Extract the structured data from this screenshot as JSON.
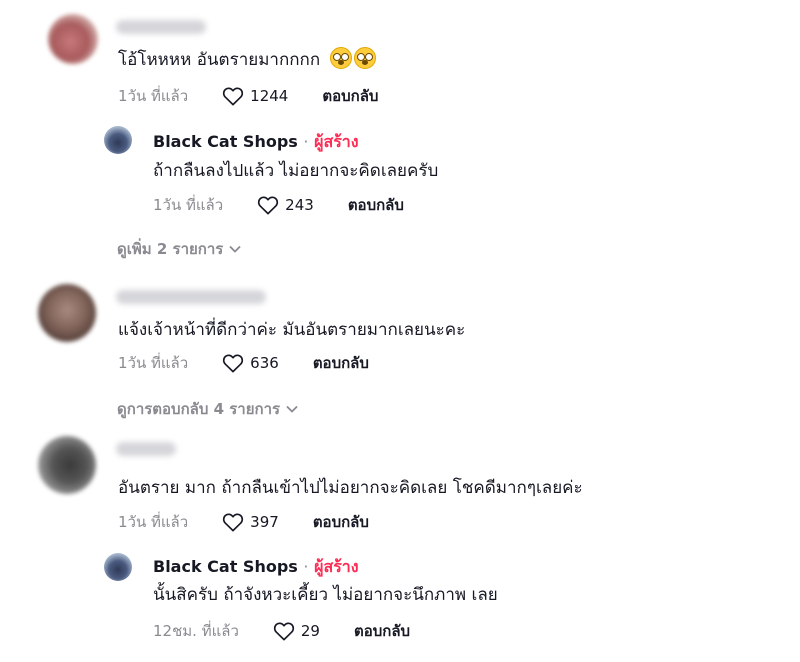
{
  "comments": [
    {
      "text": "โอ้โหหหห อันตรายมากกกก",
      "emoji": [
        "flushed-face-emoji",
        "flushed-face-emoji"
      ],
      "time": "1วัน ที่แล้ว",
      "likes": "1244",
      "reply_label": "ตอบกลับ",
      "reply": {
        "author": "Black Cat Shops",
        "separator": "·",
        "badge": "ผู้สร้าง",
        "text": "ถ้ากลืนลงไปแล้ว ไม่อยากจะคิดเลยครับ",
        "time": "1วัน ที่แล้ว",
        "likes": "243",
        "reply_label": "ตอบกลับ"
      },
      "more_label": "ดูเพิ่ม 2 รายการ"
    },
    {
      "text": "แจ้งเจ้าหน้าที่ดีกว่าค่ะ มันอันตรายมากเลยนะคะ",
      "time": "1วัน ที่แล้ว",
      "likes": "636",
      "reply_label": "ตอบกลับ",
      "more_label": "ดูการตอบกลับ 4 รายการ"
    },
    {
      "text": "อันตราย มาก ถ้ากลืนเข้าไปไม่อยากจะคิดเลย โชคดีมากๆเลยค่ะ",
      "time": "1วัน ที่แล้ว",
      "likes": "397",
      "reply_label": "ตอบกลับ",
      "reply": {
        "author": "Black Cat Shops",
        "separator": "·",
        "badge": "ผู้สร้าง",
        "text": "นั้นสิครับ ถ้าจังหวะเคี้ยว ไม่อยากจะนึกภาพ เลย",
        "time": "12ชม. ที่แล้ว",
        "likes": "29",
        "reply_label": "ตอบกลับ"
      }
    }
  ],
  "colors": {
    "creator_badge": "#fe2c55",
    "secondary_text": "#8a8b91",
    "primary_text": "#161823"
  },
  "icons": {
    "like": "heart-outline-icon",
    "expand": "chevron-down-icon"
  }
}
